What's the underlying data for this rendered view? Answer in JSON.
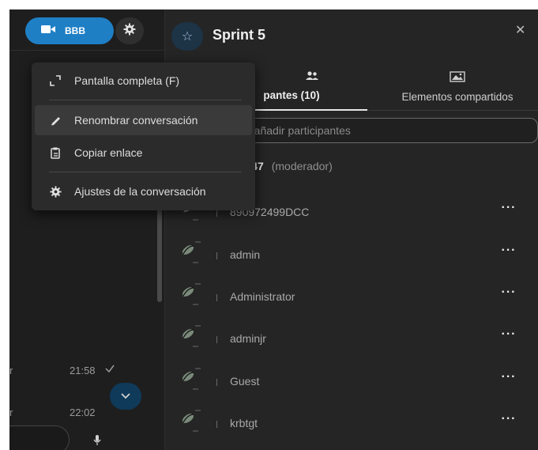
{
  "header": {
    "call_button_label": "BBB",
    "conversation_title": "Sprint 5"
  },
  "menu": {
    "items": [
      {
        "label": "Pantalla completa (F)",
        "icon": "fullscreen-icon"
      },
      {
        "label": "Renombrar conversación",
        "icon": "pencil-icon",
        "hovered": true
      },
      {
        "label": "Copiar enlace",
        "icon": "clipboard-icon"
      },
      {
        "label": "Ajustes de la conversación",
        "icon": "gear-icon"
      }
    ]
  },
  "tabs": {
    "participants": "pantes (10)",
    "shared": "Elementos compartidos"
  },
  "search": {
    "placeholder": "o añadir participantes"
  },
  "moderator": {
    "name": "elc747",
    "role": "(moderador)"
  },
  "participants": [
    {
      "name": "890972499DCC"
    },
    {
      "name": "admin"
    },
    {
      "name": "Administrator"
    },
    {
      "name": "adminjr"
    },
    {
      "name": "Guest"
    },
    {
      "name": "krbtgt"
    }
  ],
  "more_label": "···",
  "messages": [
    {
      "sender": "r",
      "time": "21:58"
    },
    {
      "sender": "r",
      "time": "22:02"
    }
  ],
  "colors": {
    "accent": "#1f7fc5",
    "panel": "#252525",
    "background": "#1e1e1e",
    "menu": "#2b2b2b"
  }
}
